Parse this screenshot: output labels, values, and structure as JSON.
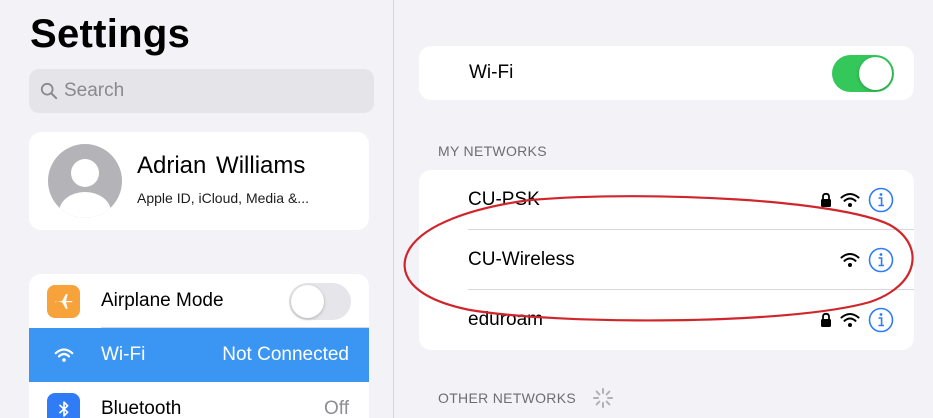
{
  "sidebar": {
    "title": "Settings",
    "search": {
      "placeholder": "Search"
    },
    "profile": {
      "name": "Adrian Williams",
      "subtitle": "Apple ID, iCloud, Media &..."
    },
    "items": [
      {
        "label": "Airplane Mode",
        "icon": "airplane-icon",
        "icon_bg": "#f7a23b",
        "control": "toggle-off"
      },
      {
        "label": "Wi-Fi",
        "icon": "wifi-icon",
        "icon_bg": "#3b96f3",
        "value": "Not Connected",
        "active": true
      },
      {
        "label": "Bluetooth",
        "icon": "bluetooth-icon",
        "icon_bg": "#2f7cf6",
        "value": "Off"
      }
    ]
  },
  "wifi": {
    "label": "Wi-Fi",
    "enabled": true
  },
  "my_networks": {
    "header": "MY NETWORKS",
    "networks": [
      {
        "name": "CU-PSK",
        "secured": true
      },
      {
        "name": "CU-Wireless",
        "secured": false
      },
      {
        "name": "eduroam",
        "secured": true
      }
    ]
  },
  "other_networks": {
    "header": "OTHER NETWORKS"
  },
  "colors": {
    "accent": "#3b96f3",
    "toggle_on": "#34c759",
    "info_blue": "#2f7cf6",
    "annotation_red": "#d0262b",
    "background": "#f2f2f7"
  }
}
